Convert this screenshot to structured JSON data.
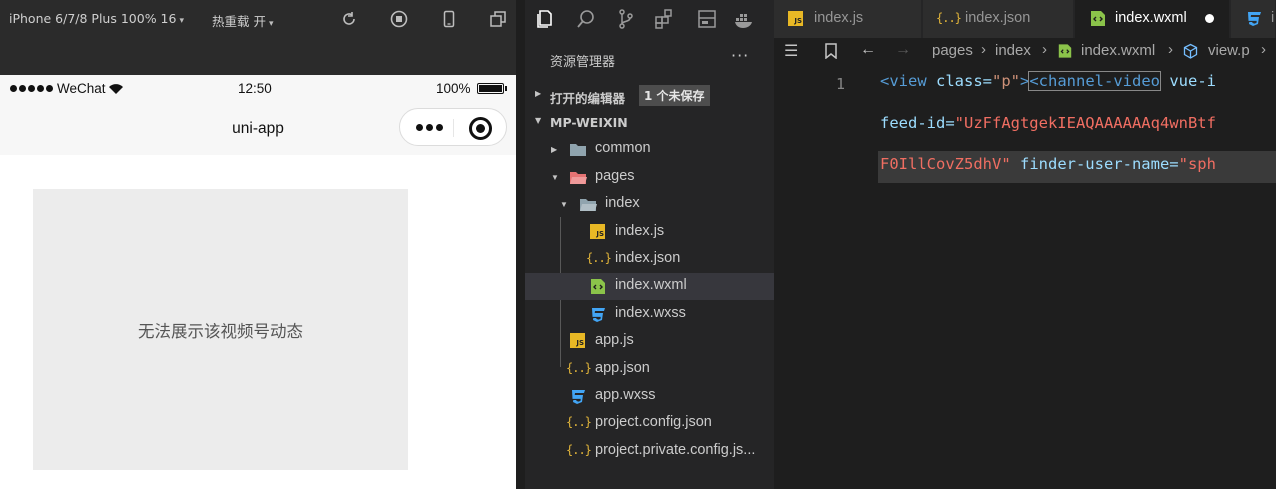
{
  "simulator": {
    "device": "iPhone 6/7/8 Plus 100% 16",
    "hot_reload": "热重载 开",
    "status": {
      "carrier": "WeChat",
      "time": "12:50",
      "battery": "100%"
    },
    "nav_title": "uni-app",
    "video_message": "无法展示该视频号动态"
  },
  "explorer": {
    "title": "资源管理器",
    "more": "···",
    "open_editors": {
      "label": "打开的编辑器",
      "badge": "1 个未保存"
    },
    "project": "MP-WEIXIN",
    "items": [
      {
        "name": "common",
        "icon": "folder-icon"
      },
      {
        "name": "pages",
        "icon": "folder-open-red-icon"
      },
      {
        "name": "index",
        "icon": "folder-open-icon"
      },
      {
        "name": "index.js",
        "icon": "js-file-icon"
      },
      {
        "name": "index.json",
        "icon": "json-file-icon"
      },
      {
        "name": "index.wxml",
        "icon": "wxml-file-icon"
      },
      {
        "name": "index.wxss",
        "icon": "css-file-icon"
      },
      {
        "name": "app.js",
        "icon": "js-file-icon"
      },
      {
        "name": "app.json",
        "icon": "json-file-icon"
      },
      {
        "name": "app.wxss",
        "icon": "css-file-icon"
      },
      {
        "name": "project.config.json",
        "icon": "json-file-icon"
      },
      {
        "name": "project.private.config.js...",
        "icon": "json-file-icon"
      }
    ]
  },
  "tabs": [
    {
      "label": "index.js"
    },
    {
      "label": "index.json"
    },
    {
      "label": "index.wxml",
      "active": true,
      "unsaved": true
    },
    {
      "label": "i"
    }
  ],
  "breadcrumb": {
    "seg1": "pages",
    "seg2": "index",
    "seg3": "index.wxml",
    "seg4": "view.p"
  },
  "code": {
    "line_number": "1",
    "l1_tag1": "<view",
    "l1_attr1": " class=",
    "l1_val1": "\"p\"",
    "l1_close": ">",
    "l1_tag2": "<channel-video",
    "l1_attr2": " vue-i",
    "l2_attr": "feed-id=",
    "l2_val": "\"UzFfAgtgekIEAQAAAAAAq4wnBtf",
    "l3_val": "F0IllCovZ5dhV\"",
    "l3_attr": " finder-user-name=",
    "l3_val2": "\"sph"
  },
  "colors": {
    "accent": "#569cd6",
    "editor_bg": "#1e1e1e",
    "sidebar_bg": "#252526"
  }
}
